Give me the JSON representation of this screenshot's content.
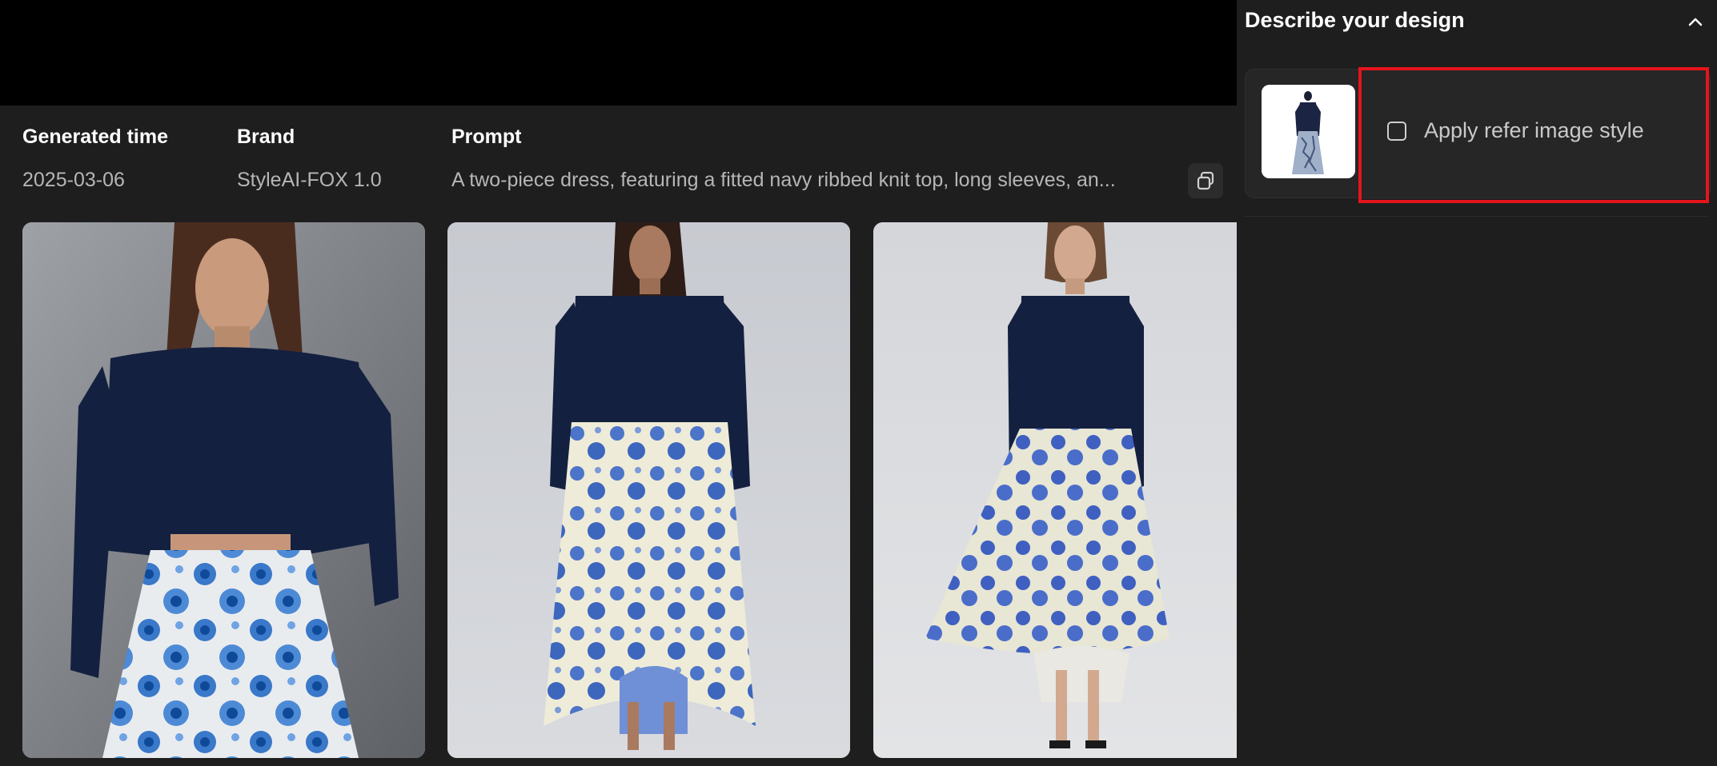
{
  "info": {
    "generated_time_label": "Generated time",
    "generated_time_value": "2025-03-06",
    "brand_label": "Brand",
    "brand_value": "StyleAI-FOX 1.0",
    "prompt_label": "Prompt",
    "prompt_value": "A two-piece dress, featuring a fitted navy ribbed knit top, long sleeves, an..."
  },
  "panel": {
    "title": "Describe your design",
    "apply_label": "Apply refer image style",
    "apply_checked": false
  },
  "gallery": {
    "images": [
      {
        "name": "generated-image-1"
      },
      {
        "name": "generated-image-2"
      },
      {
        "name": "generated-image-3"
      },
      {
        "name": "generated-image-4"
      }
    ]
  },
  "colors": {
    "background": "#1e1e1e",
    "topbar": "#000000",
    "highlight": "#e5141c",
    "navy": "#14203f",
    "floral_blue": "#3c63c4",
    "skirt_cream": "#f1ebc2"
  }
}
